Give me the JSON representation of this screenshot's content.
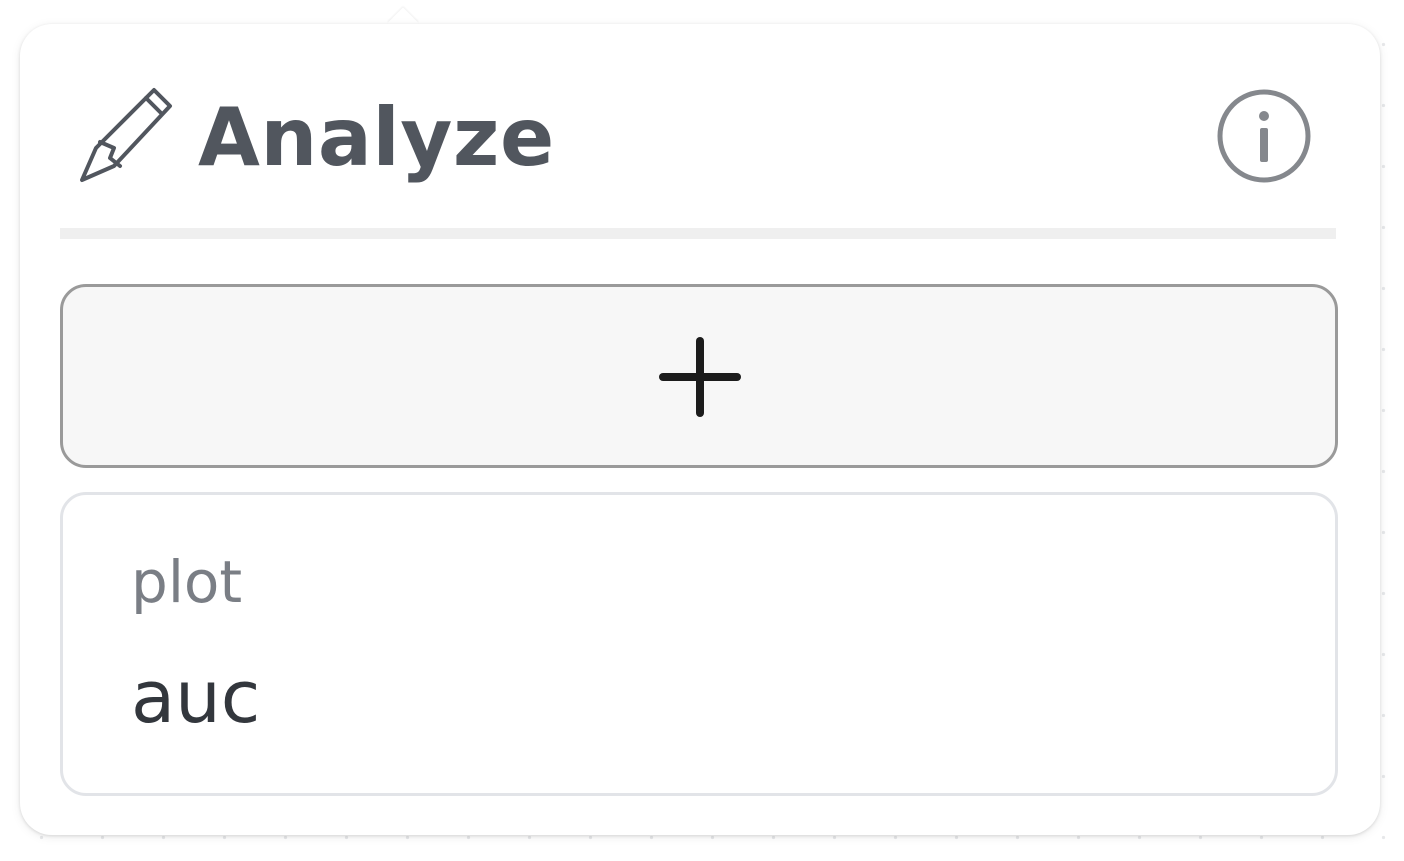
{
  "panel": {
    "title": "Analyze",
    "title_icon": "pencil-icon",
    "info_icon": "info-icon",
    "add_icon": "plus-icon"
  },
  "node": {
    "type_label": "plot",
    "name": "auc"
  },
  "colors": {
    "title_text": "#51565e",
    "icon_stroke": "#51565e",
    "info_stroke": "#85888d",
    "divider": "#efefef",
    "add_button_bg": "#f7f7f7",
    "add_button_border": "#9a9a9a",
    "plus": "#1c1c1c",
    "card_border": "#e2e4e8",
    "type_label_text": "#7a7e85",
    "node_name_text": "#33373d"
  }
}
